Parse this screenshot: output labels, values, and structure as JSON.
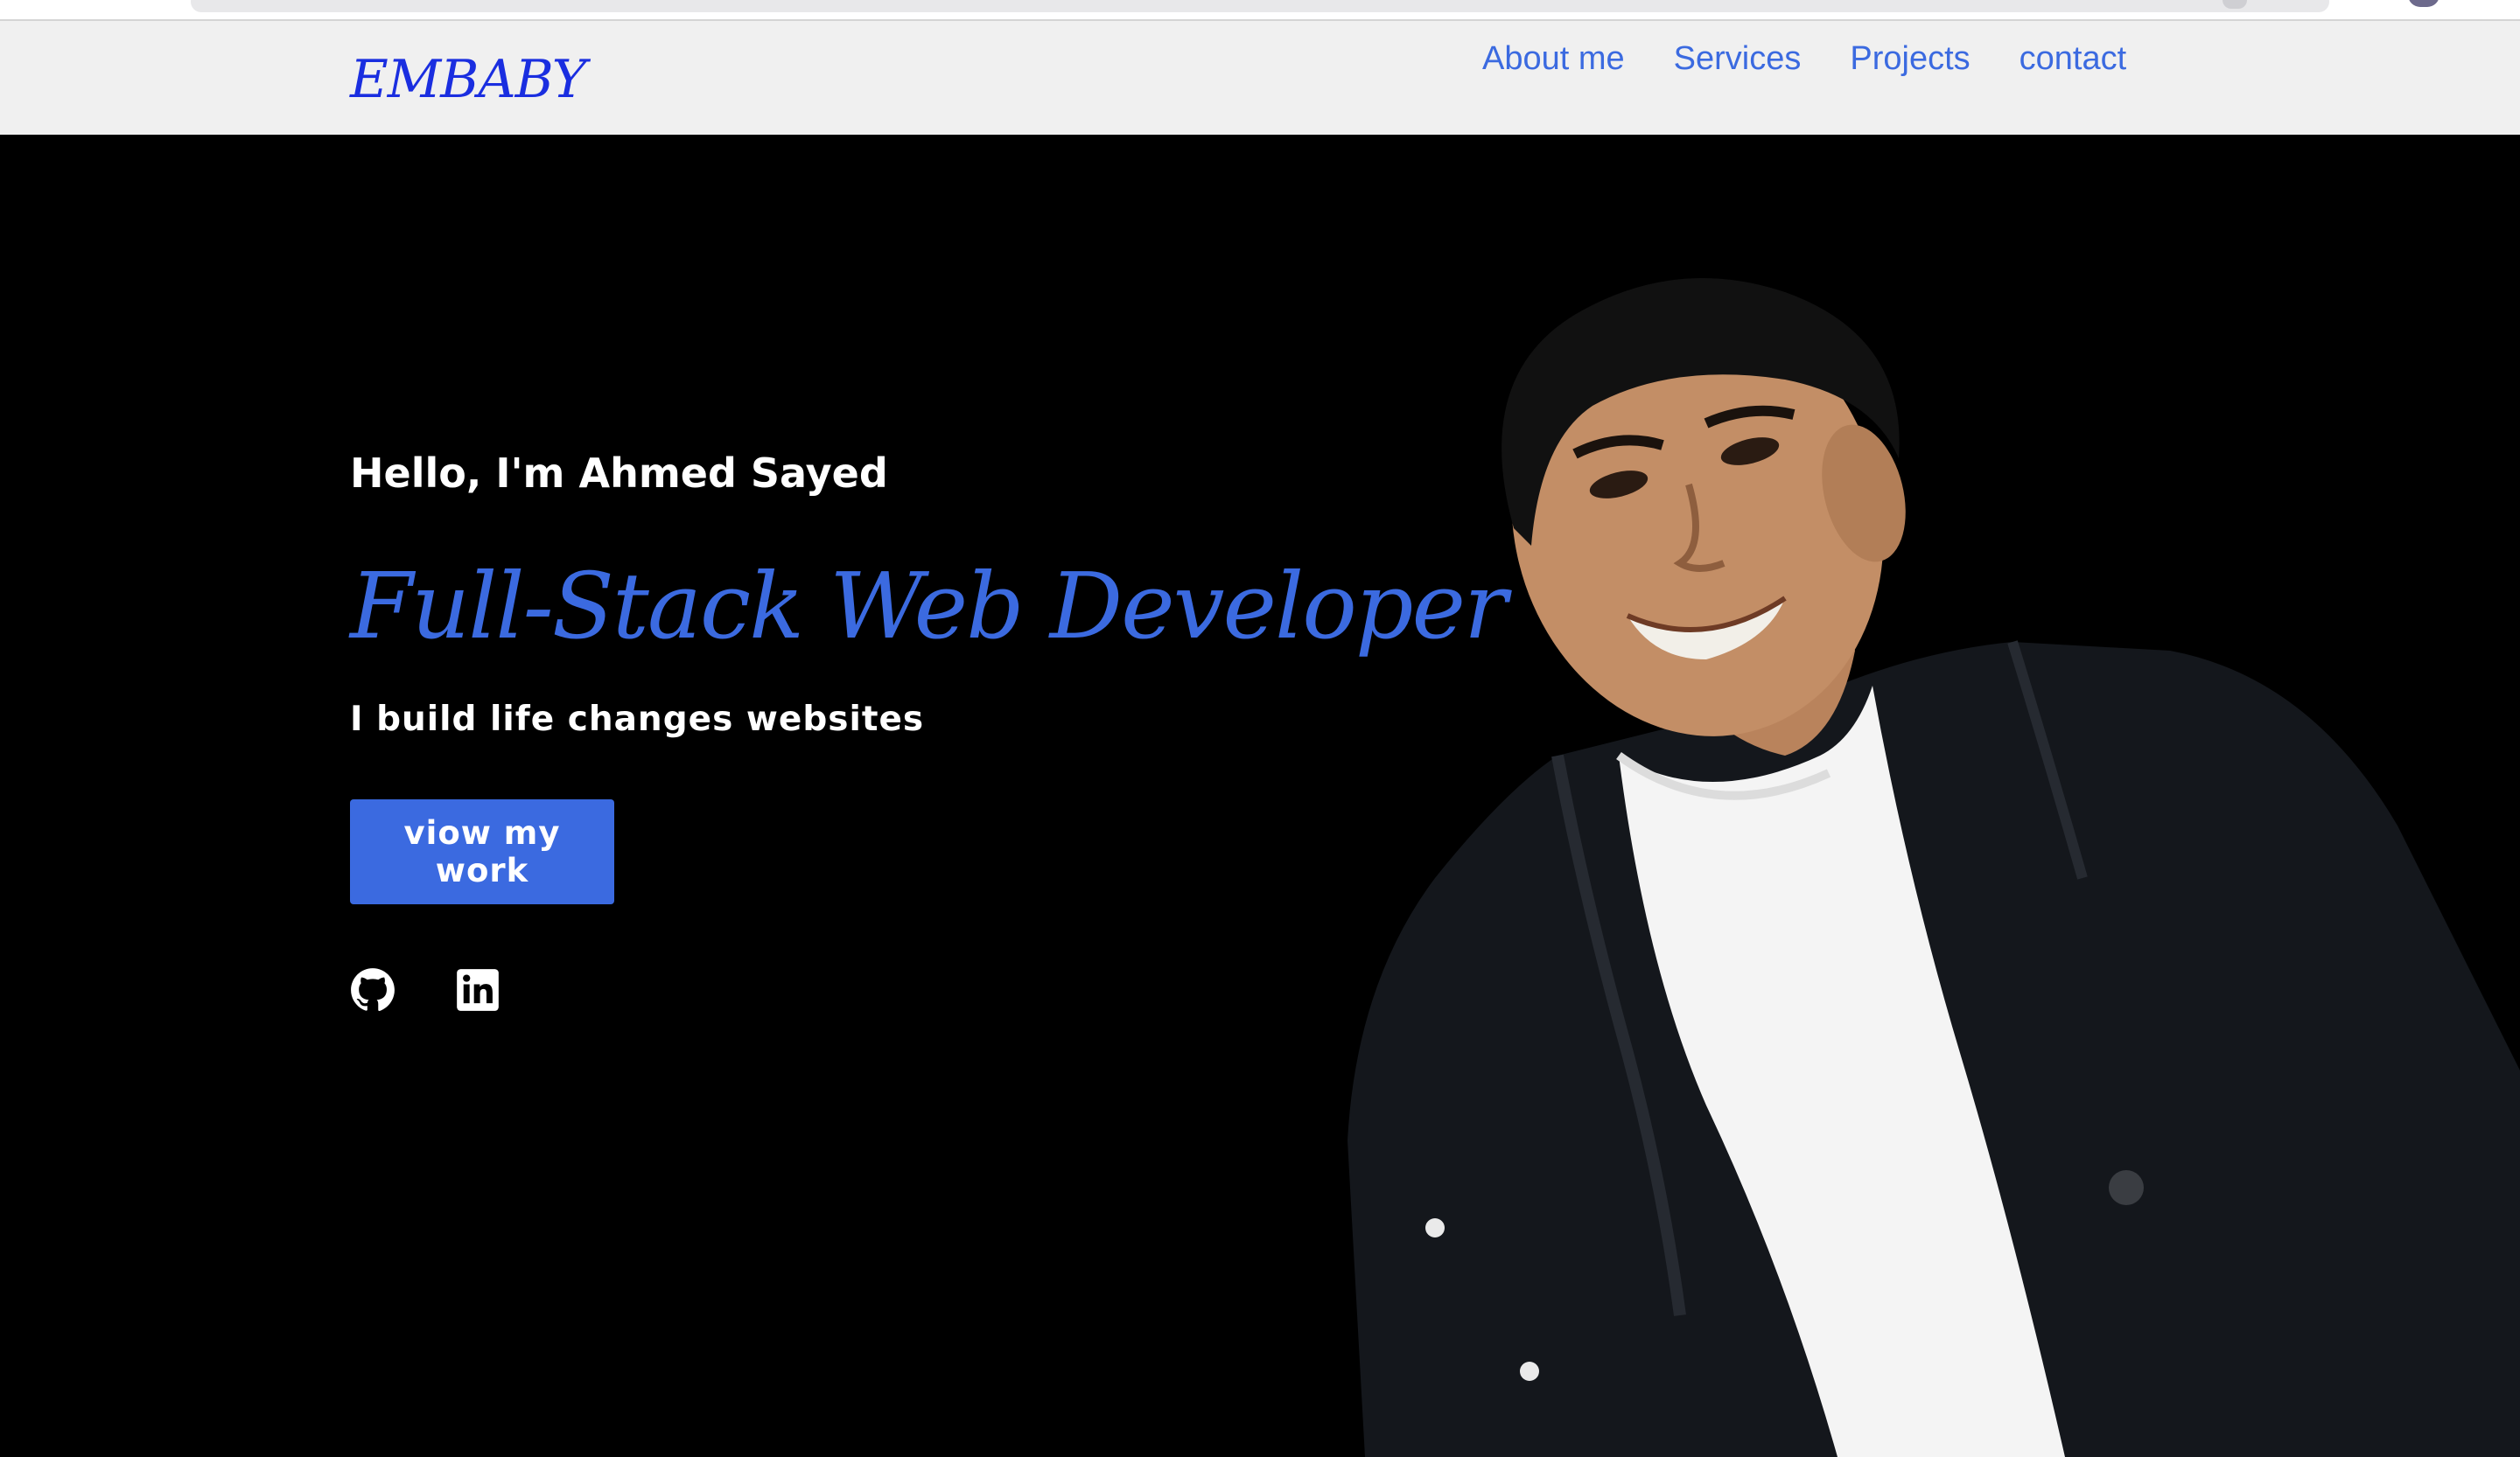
{
  "site": {
    "logo": "EMBABY",
    "brand_color": "#3b6ae0"
  },
  "nav": {
    "items": [
      {
        "label": "About me"
      },
      {
        "label": "Services"
      },
      {
        "label": "Projects"
      },
      {
        "label": "contact"
      }
    ]
  },
  "hero": {
    "greeting": "Hello, I'm Ahmed Sayed",
    "role": "Full-Stack Web Developer",
    "tagline": "I build life changes websites",
    "cta_label": "viow my work",
    "social_icons": [
      "github-icon",
      "linkedin-icon"
    ],
    "background": "#000000"
  }
}
